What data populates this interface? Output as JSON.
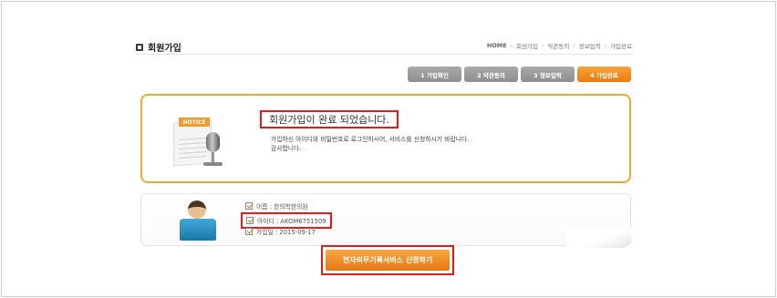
{
  "page": {
    "title": "회원가입",
    "title_icon": "square-bullet-icon"
  },
  "breadcrumb": [
    "HOME",
    "회원가입",
    "약관동의",
    "정보입력",
    "가입완료"
  ],
  "steps": [
    {
      "label": "1 가입확인",
      "active": false
    },
    {
      "label": "2 약관동의",
      "active": false
    },
    {
      "label": "3 정보입력",
      "active": false
    },
    {
      "label": "4 가입완료",
      "active": true
    }
  ],
  "notice": {
    "tag": "NOTICE",
    "headline": "회원가입이 완료 되었습니다.",
    "message_line1": "가입하신 아이디와 비밀번호로 로그인하시어, 서비스를 신청하시기 바랍니다.",
    "message_line2": "감사합니다."
  },
  "member_info": {
    "name": "이름 : 한의학한의원",
    "user_id": "아이디 : AKOM6751509",
    "join_date": "가입일 : 2015-09-17"
  },
  "actions": {
    "apply_label": "전자의무기록서비스 신청하기"
  },
  "colors": {
    "accent_orange": "#ee8a1e",
    "step_gray": "#9a9a9a",
    "highlight_red": "#e41b1b",
    "notice_border": "#f0a83a"
  }
}
